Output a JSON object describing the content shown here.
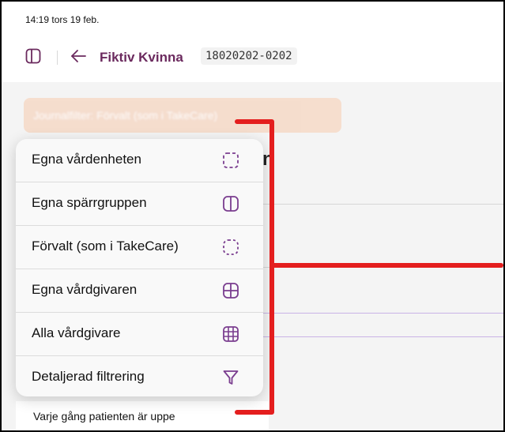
{
  "status_bar": {
    "time_date": "14:19  tors 19 feb."
  },
  "header": {
    "patient_name": "Fiktiv Kvinna",
    "patient_id": "18020202-0202"
  },
  "filter_button": {
    "label": "Journalfilter: Förvalt (som i TakeCare)"
  },
  "background": {
    "heading_fragment": "n",
    "footer_text": "Varje gång patienten är uppe"
  },
  "menu": {
    "items": [
      {
        "label": "Egna vårdenheten",
        "icon": "dashed-square-icon"
      },
      {
        "label": "Egna spärrgruppen",
        "icon": "split-square-icon"
      },
      {
        "label": "Förvalt (som i TakeCare)",
        "icon": "dashed-rounded-square-icon"
      },
      {
        "label": "Egna vårdgivaren",
        "icon": "quad-grid-icon"
      },
      {
        "label": "Alla vårdgivare",
        "icon": "nine-grid-icon"
      },
      {
        "label": "Detaljerad filtrering",
        "icon": "filter-funnel-icon"
      }
    ]
  },
  "colors": {
    "accent_purple": "#6b2a5e",
    "menu_icon_purple": "#7a3d8f",
    "annotation_red": "#e41e1e",
    "pill_bg": "#f6d9c7"
  }
}
